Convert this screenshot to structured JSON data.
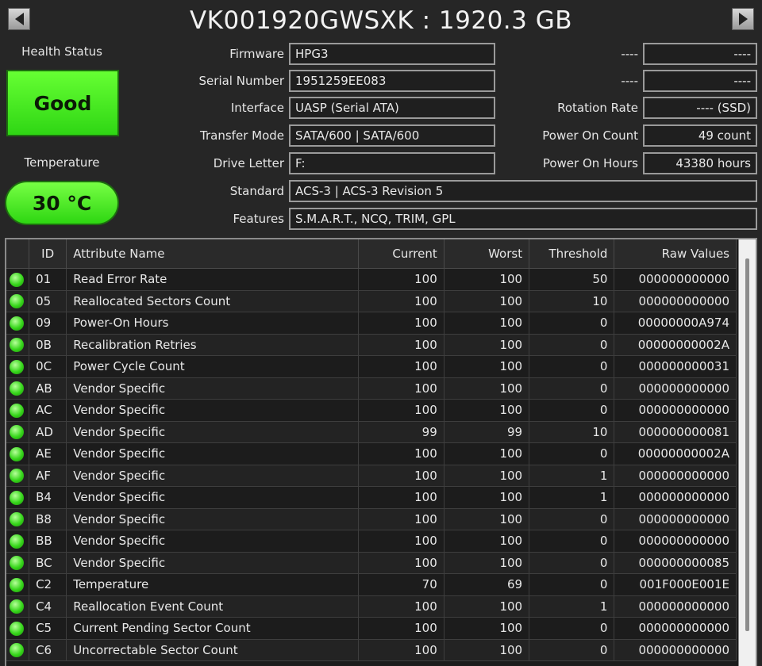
{
  "header": {
    "title": "VK001920GWSXK : 1920.3 GB"
  },
  "status": {
    "health_label": "Health Status",
    "health_value": "Good",
    "temp_label": "Temperature",
    "temp_value": "30 °C"
  },
  "info": {
    "firmware_label": "Firmware",
    "firmware": "HPG3",
    "serial_label": "Serial Number",
    "serial": "1951259EE083",
    "interface_label": "Interface",
    "interface": "UASP (Serial ATA)",
    "transfer_label": "Transfer Mode",
    "transfer": "SATA/600 | SATA/600",
    "drive_letter_label": "Drive Letter",
    "drive_letter": "F:",
    "standard_label": "Standard",
    "standard": "ACS-3 | ACS-3 Revision 5",
    "features_label": "Features",
    "features": "S.M.A.R.T., NCQ, TRIM, GPL",
    "blank1_label": "----",
    "blank1": "----",
    "blank2_label": "----",
    "blank2": "----",
    "rotation_label": "Rotation Rate",
    "rotation": "---- (SSD)",
    "power_count_label": "Power On Count",
    "power_count": "49 count",
    "power_hours_label": "Power On Hours",
    "power_hours": "43380 hours"
  },
  "table": {
    "headers": [
      "ID",
      "Attribute Name",
      "Current",
      "Worst",
      "Threshold",
      "Raw Values"
    ],
    "rows": [
      [
        "01",
        "Read Error Rate",
        "100",
        "100",
        "50",
        "000000000000"
      ],
      [
        "05",
        "Reallocated Sectors Count",
        "100",
        "100",
        "10",
        "000000000000"
      ],
      [
        "09",
        "Power-On Hours",
        "100",
        "100",
        "0",
        "00000000A974"
      ],
      [
        "0B",
        "Recalibration Retries",
        "100",
        "100",
        "0",
        "00000000002A"
      ],
      [
        "0C",
        "Power Cycle Count",
        "100",
        "100",
        "0",
        "000000000031"
      ],
      [
        "AB",
        "Vendor Specific",
        "100",
        "100",
        "0",
        "000000000000"
      ],
      [
        "AC",
        "Vendor Specific",
        "100",
        "100",
        "0",
        "000000000000"
      ],
      [
        "AD",
        "Vendor Specific",
        "99",
        "99",
        "10",
        "000000000081"
      ],
      [
        "AE",
        "Vendor Specific",
        "100",
        "100",
        "0",
        "00000000002A"
      ],
      [
        "AF",
        "Vendor Specific",
        "100",
        "100",
        "1",
        "000000000000"
      ],
      [
        "B4",
        "Vendor Specific",
        "100",
        "100",
        "1",
        "000000000000"
      ],
      [
        "B8",
        "Vendor Specific",
        "100",
        "100",
        "0",
        "000000000000"
      ],
      [
        "BB",
        "Vendor Specific",
        "100",
        "100",
        "0",
        "000000000000"
      ],
      [
        "BC",
        "Vendor Specific",
        "100",
        "100",
        "0",
        "000000000085"
      ],
      [
        "C2",
        "Temperature",
        "70",
        "69",
        "0",
        "001F000E001E"
      ],
      [
        "C4",
        "Reallocation Event Count",
        "100",
        "100",
        "1",
        "000000000000"
      ],
      [
        "C5",
        "Current Pending Sector Count",
        "100",
        "100",
        "0",
        "000000000000"
      ],
      [
        "C6",
        "Uncorrectable Sector Count",
        "100",
        "100",
        "0",
        "000000000000"
      ]
    ]
  },
  "colors": {
    "good": "#3ddc1f",
    "background": "#262626"
  },
  "icons": {
    "prev": "triangle-left-icon",
    "next": "triangle-right-icon",
    "status": "good-status-dot-icon"
  }
}
